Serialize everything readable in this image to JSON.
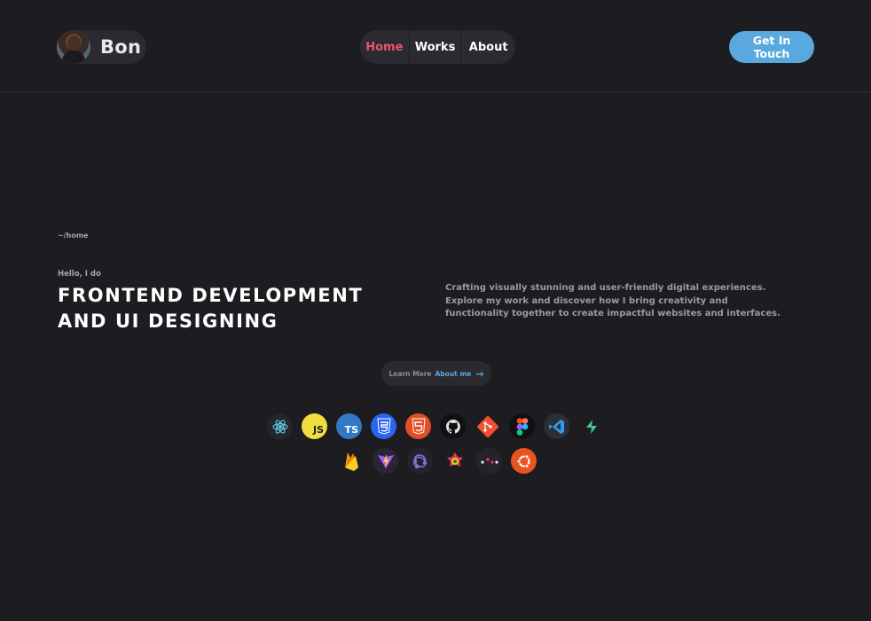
{
  "header": {
    "brand_name": "Bon",
    "nav": [
      "Home",
      "Works",
      "About"
    ],
    "active_nav": "Home",
    "cta_label": "Get In Touch"
  },
  "hero": {
    "breadcrumb": "~/home",
    "greeting": "Hello, I do",
    "headline_line1": "FRONTEND DEVELOPMENT",
    "headline_line2": "AND UI DESIGNING",
    "description": "Crafting visually stunning and user-friendly digital experiences. Explore my work and discover how I bring creativity and functionality together to create impactful websites and interfaces.",
    "learn_prefix": "Learn More",
    "learn_link": "About me"
  },
  "tech_icons": {
    "row1": [
      "react-icon",
      "javascript-icon",
      "typescript-icon",
      "css3-icon",
      "html5-icon",
      "github-icon",
      "git-icon",
      "figma-icon",
      "vscode-icon",
      "supabase-icon"
    ],
    "row2": [
      "firebase-icon",
      "vite-icon",
      "redux-icon",
      "framer-icon",
      "dots-icon",
      "ubuntu-icon"
    ],
    "js_label": "JS",
    "ts_label": "TS"
  },
  "colors": {
    "background": "#1d1d21",
    "surface": "#2a2a30",
    "accent_blue": "#5aa9de",
    "active_nav": "#e8566a"
  }
}
